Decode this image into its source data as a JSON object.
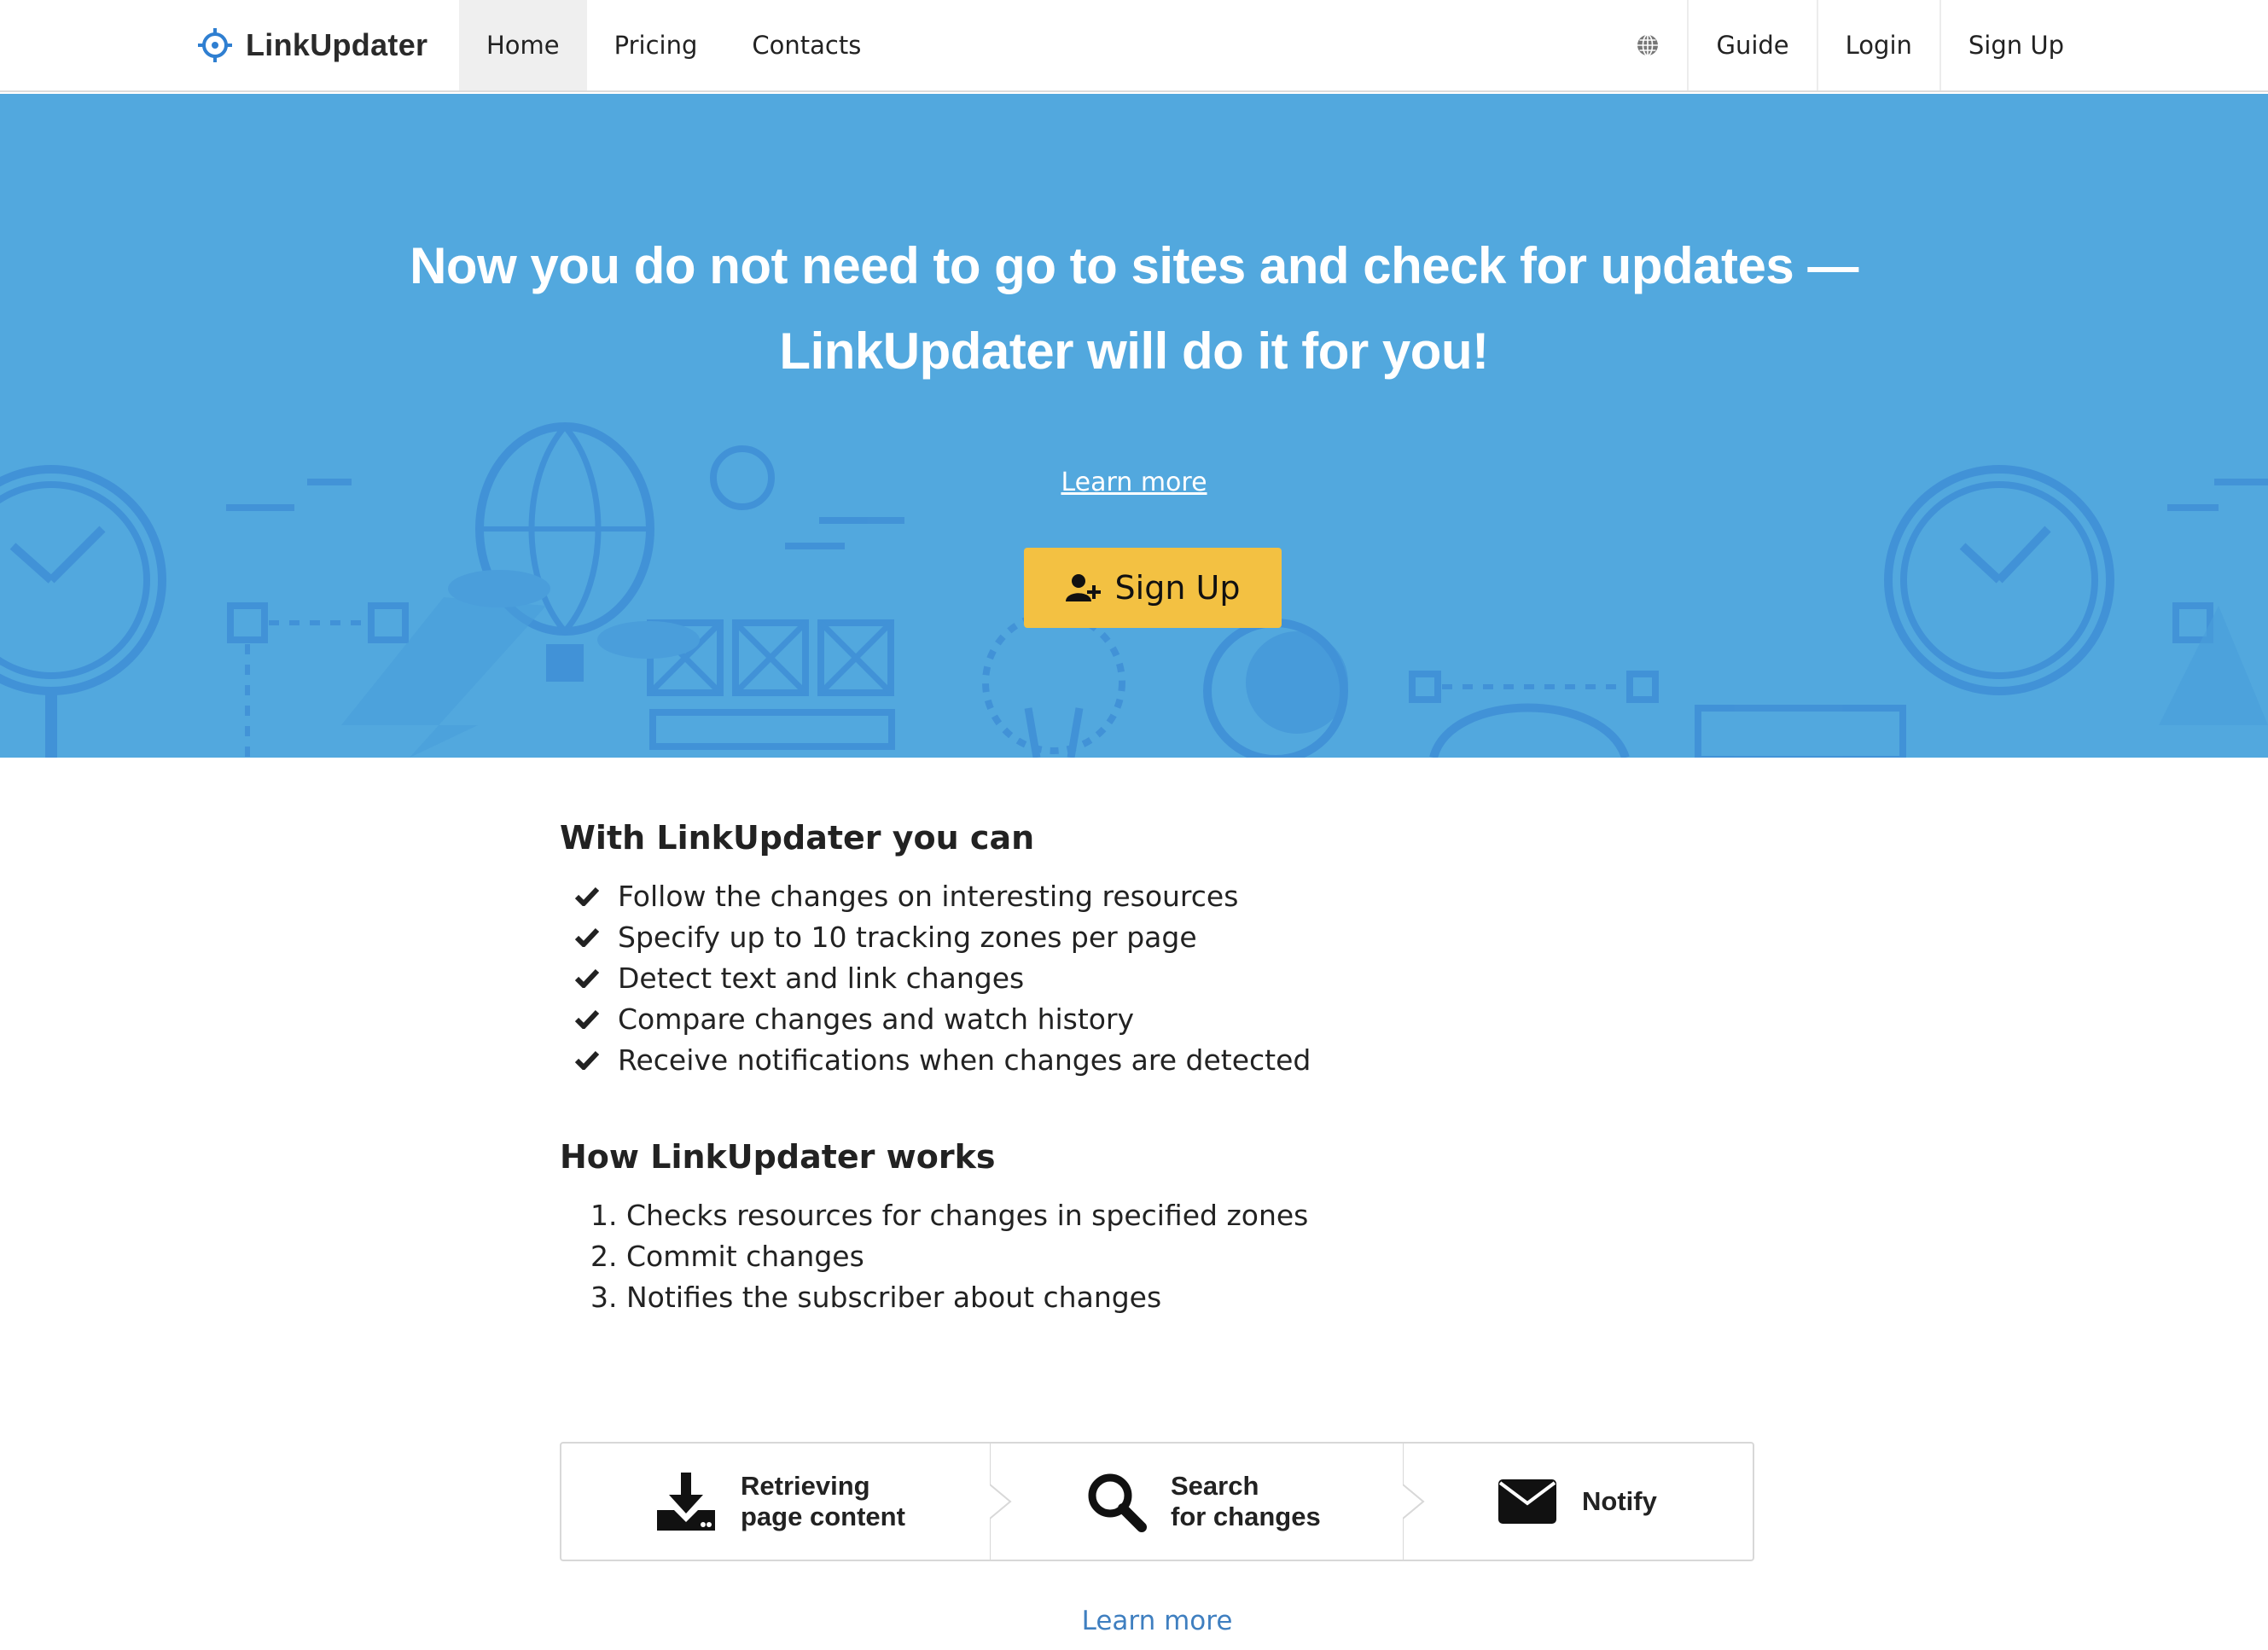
{
  "nav": {
    "brand": "LinkUpdater",
    "left_items": [
      "Home",
      "Pricing",
      "Contacts"
    ],
    "active_item": "Home",
    "right_items": [
      "Guide",
      "Login",
      "Sign Up"
    ]
  },
  "hero": {
    "title_line1": "Now you do not need to go to sites and check for updates —",
    "title_line2": "LinkUpdater will do it for you!",
    "learn_more": "Learn more",
    "signup_button": "Sign Up"
  },
  "features": {
    "title": "With LinkUpdater you can",
    "items": [
      "Follow the changes on interesting resources",
      "Specify up to 10 tracking zones per page",
      "Detect text and link changes",
      "Compare changes and watch history",
      "Receive notifications when changes are detected"
    ]
  },
  "how": {
    "title": "How LinkUpdater works",
    "steps": [
      "Checks resources for changes in specified zones",
      "Commit changes",
      "Notifies the subscriber about changes"
    ]
  },
  "process": {
    "step1_line1": "Retrieving",
    "step1_line2": "page content",
    "step2_line1": "Search",
    "step2_line2": "for changes",
    "step3": "Notify"
  },
  "footer": {
    "learn_more": "Learn more"
  },
  "colors": {
    "hero_bg": "#52a8de",
    "button": "#f3c142",
    "link": "#3f7fc0",
    "brand_icon": "#2f7fd1"
  }
}
